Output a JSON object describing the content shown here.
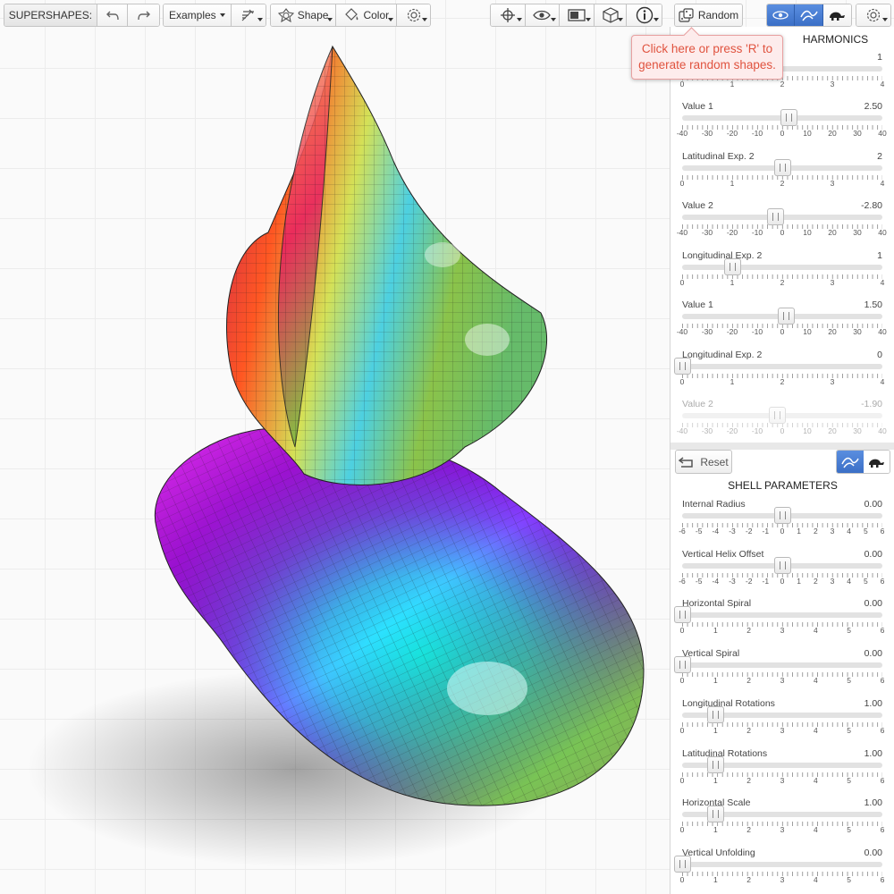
{
  "toolbar": {
    "app_label": "SUPERSHAPES:",
    "examples_label": "Examples",
    "shape_label": "Shape",
    "color_label": "Color",
    "random_label": "Random"
  },
  "icons": [
    "undo-icon",
    "redo-icon",
    "magic-wand-icon",
    "shape-icon",
    "paint-bucket-icon",
    "gear-icon",
    "crosshair-icon",
    "eye-icon",
    "screen-icon",
    "cube-icon",
    "info-icon",
    "dice-icon",
    "orbit-icon",
    "wave-icon",
    "turtle-icon",
    "reset-icon"
  ],
  "tooltip": {
    "text": "Click here or press 'R' to generate random shapes."
  },
  "harmonics": {
    "title": "HARMONICS",
    "top_value": "1",
    "top_ticks": [
      "0",
      "1",
      "2",
      "3",
      "4"
    ],
    "sliders": [
      {
        "label": "Value 1",
        "value": "2.50",
        "ticks": [
          "-40",
          "-30",
          "-20",
          "-10",
          "0",
          "10",
          "20",
          "30",
          "40"
        ],
        "pos": 0.53,
        "disabled": false
      },
      {
        "label": "Latitudinal Exp. 2",
        "value": "2",
        "ticks": [
          "0",
          "1",
          "2",
          "3",
          "4"
        ],
        "pos": 0.5,
        "disabled": false
      },
      {
        "label": "Value 2",
        "value": "-2.80",
        "ticks": [
          "-40",
          "-30",
          "-20",
          "-10",
          "0",
          "10",
          "20",
          "30",
          "40"
        ],
        "pos": 0.465,
        "disabled": false
      },
      {
        "label": "Longitudinal Exp. 2",
        "value": "1",
        "ticks": [
          "0",
          "1",
          "2",
          "3",
          "4"
        ],
        "pos": 0.25,
        "disabled": false
      },
      {
        "label": "Value 1",
        "value": "1.50",
        "ticks": [
          "-40",
          "-30",
          "-20",
          "-10",
          "0",
          "10",
          "20",
          "30",
          "40"
        ],
        "pos": 0.52,
        "disabled": false
      },
      {
        "label": "Longitudinal Exp. 2",
        "value": "0",
        "ticks": [
          "0",
          "1",
          "2",
          "3",
          "4"
        ],
        "pos": 0.0,
        "disabled": false
      },
      {
        "label": "Value 2",
        "value": "-1.90",
        "ticks": [
          "-40",
          "-30",
          "-20",
          "-10",
          "0",
          "10",
          "20",
          "30",
          "40"
        ],
        "pos": 0.475,
        "disabled": true
      }
    ]
  },
  "shell": {
    "reset_label": "Reset",
    "title": "SHELL PARAMETERS",
    "sliders": [
      {
        "label": "Internal Radius",
        "value": "0.00",
        "ticks": [
          "-6",
          "-5",
          "-4",
          "-3",
          "-2",
          "-1",
          "0",
          "1",
          "2",
          "3",
          "4",
          "5",
          "6"
        ],
        "pos": 0.5
      },
      {
        "label": "Vertical Helix Offset",
        "value": "0.00",
        "ticks": [
          "-6",
          "-5",
          "-4",
          "-3",
          "-2",
          "-1",
          "0",
          "1",
          "2",
          "3",
          "4",
          "5",
          "6"
        ],
        "pos": 0.5
      },
      {
        "label": "Horizontal Spiral",
        "value": "0.00",
        "ticks": [
          "0",
          "1",
          "2",
          "3",
          "4",
          "5",
          "6"
        ],
        "pos": 0.0
      },
      {
        "label": "Vertical Spiral",
        "value": "0.00",
        "ticks": [
          "0",
          "1",
          "2",
          "3",
          "4",
          "5",
          "6"
        ],
        "pos": 0.0
      },
      {
        "label": "Longitudinal Rotations",
        "value": "1.00",
        "ticks": [
          "0",
          "1",
          "2",
          "3",
          "4",
          "5",
          "6"
        ],
        "pos": 0.1667
      },
      {
        "label": "Latitudinal Rotations",
        "value": "1.00",
        "ticks": [
          "0",
          "1",
          "2",
          "3",
          "4",
          "5",
          "6"
        ],
        "pos": 0.1667
      },
      {
        "label": "Horizontal Scale",
        "value": "1.00",
        "ticks": [
          "0",
          "1",
          "2",
          "3",
          "4",
          "5",
          "6"
        ],
        "pos": 0.1667
      },
      {
        "label": "Vertical Unfolding",
        "value": "0.00",
        "ticks": [
          "0",
          "1",
          "2",
          "3",
          "4",
          "5",
          "6"
        ],
        "pos": 0.0
      }
    ]
  },
  "colors": {
    "accent": "#3b6fc6",
    "tooltip_text": "#e0533f"
  }
}
